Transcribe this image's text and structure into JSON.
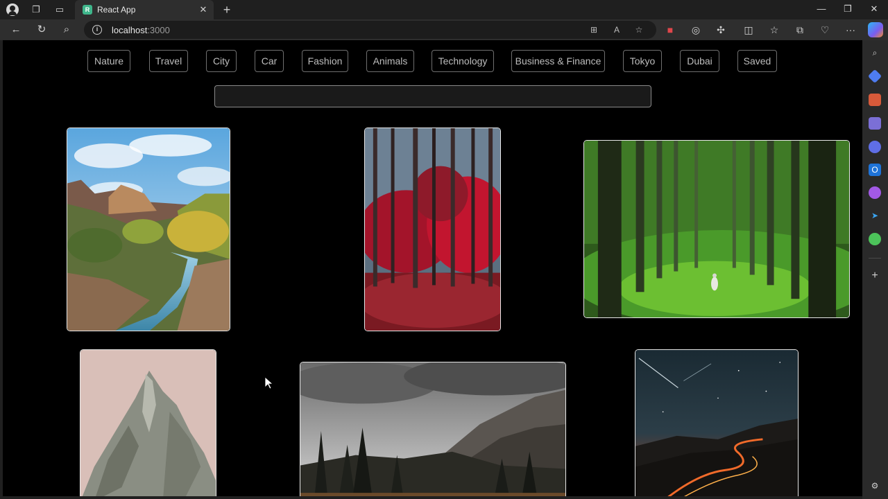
{
  "browser": {
    "tab_title": "React App",
    "favicon_letter": "R",
    "url_host": "localhost",
    "url_port": ":3000"
  },
  "categories": [
    "Nature",
    "Travel",
    "City",
    "Car",
    "Fashion",
    "Animals",
    "Technology",
    "Business & Finance",
    "Tokyo",
    "Dubai",
    "Saved"
  ],
  "search": {
    "value": "",
    "placeholder": ""
  },
  "colors": {
    "page_bg": "#000000",
    "button_border": "#6f6f6f",
    "photo_border": "#e8e8e8"
  }
}
